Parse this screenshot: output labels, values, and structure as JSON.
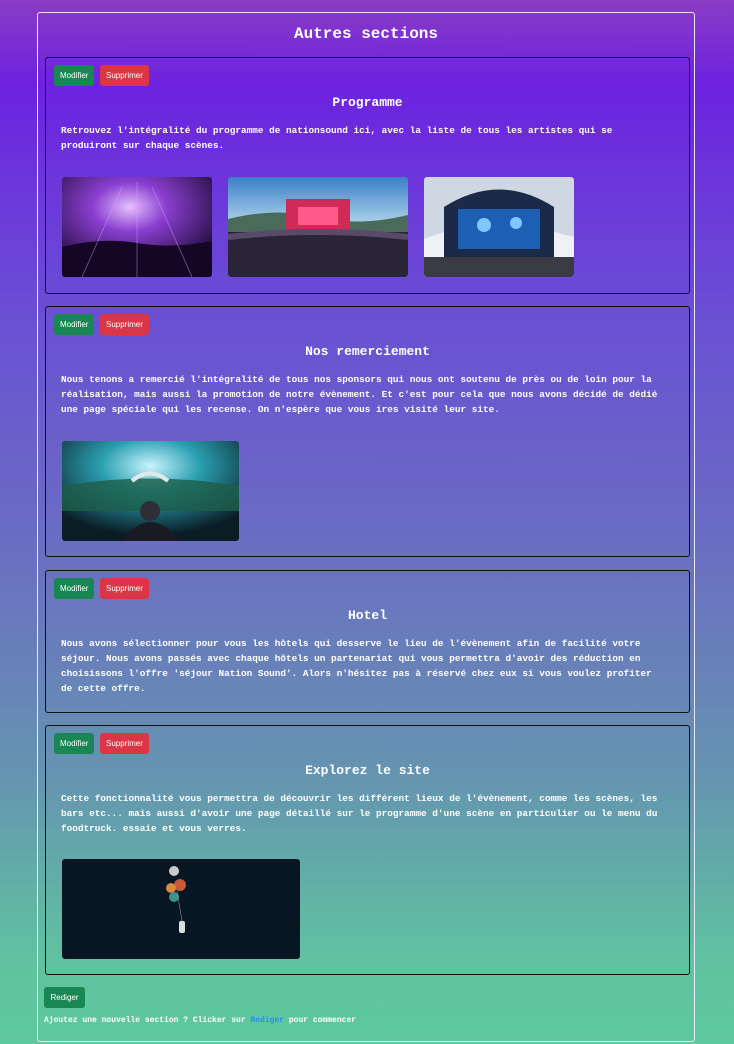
{
  "page": {
    "title": "Autres sections"
  },
  "sections": [
    {
      "title": "Programme",
      "text": "Retrouvez l'intégralité du programme de nationsound ici, avec la liste de tous les artistes qui se produiront sur chaque scènes.",
      "edit_label": "Modifier",
      "delete_label": "Supprimer"
    },
    {
      "title": "Nos remerciement",
      "text": "Nous tenons a remercié l'intégralité de tous nos sponsors qui nous ont soutenu de près ou de loin pour la réalisation, mais aussi la promotion de notre évènement. Et c'est pour cela que nous avons décidé de dédié une page spéciale qui les recense. On n'espère que vous ires visité leur site.",
      "edit_label": "Modifier",
      "delete_label": "Supprimer"
    },
    {
      "title": "Hotel",
      "text": "Nous avons sélectionner pour vous les hôtels qui desserve le lieu de l'évènement afin de facilité votre séjour. Nous avons passés avec chaque hôtels un partenariat qui vous permettra d'avoir des réduction en choisissons l'offre 'séjour Nation Sound'. Alors n'hésitez pas à réservé chez eux si vous voulez profiter de cette offre.",
      "edit_label": "Modifier",
      "delete_label": "Supprimer"
    },
    {
      "title": "Explorez le site",
      "text": "Cette fonctionnalité vous permettra de découvrir les différent lieux de l'évènement, comme les scènes, les bars etc... mais aussi d'avoir une page détaillé sur le programme d'une scène en particulier ou le menu du foodtruck. essaie et vous verres.",
      "edit_label": "Modifier",
      "delete_label": "Supprimer"
    }
  ],
  "footer": {
    "rediger_button": "Rediger",
    "text_before": "Ajoutez une nouvelle section ? Clicker sur ",
    "link": "Rediger",
    "text_after": " pour commencer"
  },
  "colors": {
    "edit": "#198754",
    "delete": "#dc3545",
    "link": "#2a8cff"
  }
}
